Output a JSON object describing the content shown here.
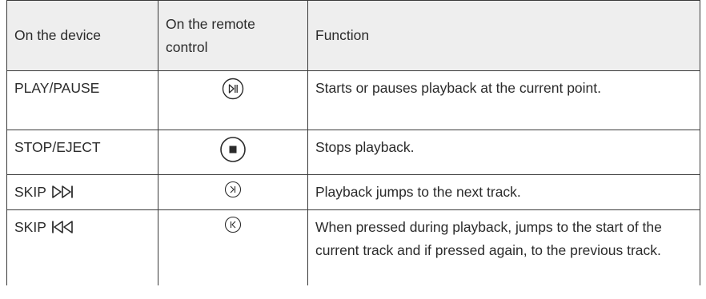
{
  "headers": {
    "device": "On the device",
    "remote": "On the remote control",
    "function": "Function"
  },
  "rows": [
    {
      "device": "PLAY/PAUSE",
      "remote_icon": "play-pause-icon",
      "function": "Starts or pauses playback at the current point."
    },
    {
      "device": "STOP/EJECT",
      "remote_icon": "stop-icon",
      "function": "Stops playback."
    },
    {
      "device": "SKIP",
      "device_icon": "skip-forward-icon",
      "remote_icon": "next-track-icon",
      "function": "Playback jumps to the next track."
    },
    {
      "device": "SKIP",
      "device_icon": "skip-back-icon",
      "remote_icon": "previous-track-icon",
      "function": "When pressed during playback, jumps to the start of the current track and if pressed again, to the previous track."
    }
  ]
}
